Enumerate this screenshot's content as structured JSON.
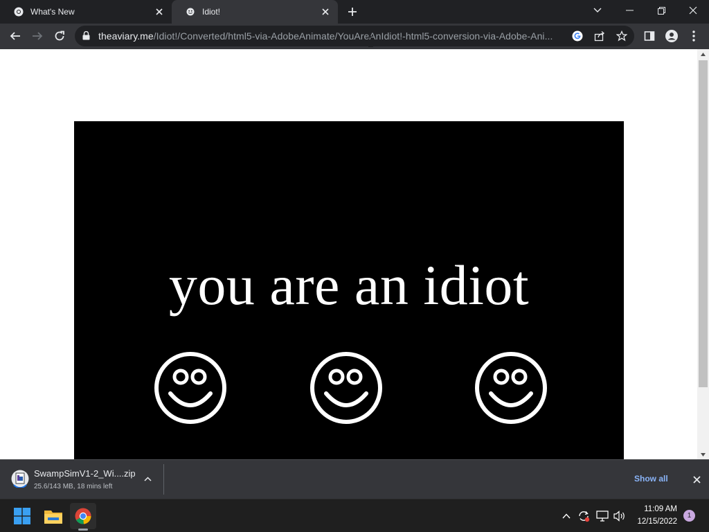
{
  "browser": {
    "tabs": [
      {
        "title": "What's New",
        "active": false,
        "icon": "chrome-icon"
      },
      {
        "title": "Idiot!",
        "active": true,
        "icon": "smiley-favicon-icon"
      }
    ],
    "url_host": "theaviary.me",
    "url_path": "/Idiot!/Converted/html5-via-AdobeAnimate/YouAreAnIdiot!-html5-conversion-via-Adobe-Ani..."
  },
  "page": {
    "message": "you are an idiot",
    "stage_color": "#000000",
    "smiley_count": 3
  },
  "download": {
    "filename": "SwampSimV1-2_Wi....zip",
    "status": "25.6/143 MB, 18 mins left",
    "show_all_label": "Show all"
  },
  "taskbar": {
    "time": "11:09 AM",
    "date": "12/15/2022",
    "notification_count": "1"
  },
  "colors": {
    "accent_link": "#8ab4f8",
    "toolbar": "#35363a",
    "tabstrip": "#202124"
  }
}
